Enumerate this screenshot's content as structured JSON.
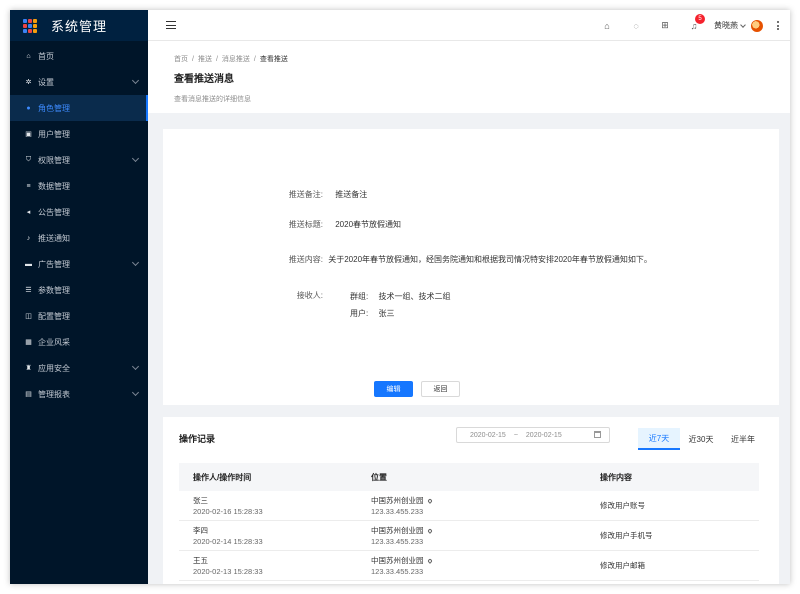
{
  "sidebar": {
    "title": "系统管理",
    "items": [
      {
        "label": "首页",
        "icon": "home-icon",
        "glyph": "⌂",
        "expand": false
      },
      {
        "label": "设置",
        "icon": "gear-icon",
        "glyph": "✲",
        "expand": true
      },
      {
        "label": "角色管理",
        "icon": "role-icon",
        "glyph": "●",
        "expand": false,
        "active": true
      },
      {
        "label": "用户管理",
        "icon": "user-icon",
        "glyph": "▣",
        "expand": false
      },
      {
        "label": "权限管理",
        "icon": "shield-icon",
        "glyph": "⛉",
        "expand": true
      },
      {
        "label": "数据管理",
        "icon": "data-icon",
        "glyph": "≡",
        "expand": false
      },
      {
        "label": "公告管理",
        "icon": "megaphone-icon",
        "glyph": "◂",
        "expand": false
      },
      {
        "label": "推送通知",
        "icon": "bell-icon",
        "glyph": "♪",
        "expand": false
      },
      {
        "label": "广告管理",
        "icon": "ad-icon",
        "glyph": "▬",
        "expand": true
      },
      {
        "label": "参数管理",
        "icon": "params-icon",
        "glyph": "☰",
        "expand": false
      },
      {
        "label": "配置管理",
        "icon": "config-icon",
        "glyph": "◫",
        "expand": false
      },
      {
        "label": "企业风采",
        "icon": "grid-icon",
        "glyph": "▦",
        "expand": false
      },
      {
        "label": "应用安全",
        "icon": "lock-icon",
        "glyph": "♜",
        "expand": true
      },
      {
        "label": "管理报表",
        "icon": "report-icon",
        "glyph": "▤",
        "expand": true
      }
    ]
  },
  "topbar": {
    "notification_count": "5",
    "username": "黄晓燕"
  },
  "header": {
    "breadcrumb": [
      "首页",
      "推送",
      "消息推送",
      "查看推送"
    ],
    "title": "查看推送消息",
    "description": "查看消息推送的详细信息"
  },
  "detail": {
    "remark_label": "推送备注:",
    "remark_value": "推送备注",
    "title_label": "推送标题:",
    "title_value": "2020春节放假通知",
    "content_label": "推送内容:",
    "content_value": "关于2020年春节放假通知，经国务院通知和根据我司情况特安排2020年春节放假通知如下。",
    "receiver_label": "接收人:",
    "group_label": "群组:",
    "group_value": "技术一组、技术二组",
    "user_label": "用户:",
    "user_value": "张三",
    "edit_button": "编辑",
    "back_button": "返回"
  },
  "records": {
    "title": "操作记录",
    "date_start": "2020-02-15",
    "date_sep": "~",
    "date_end": "2020-02-15",
    "tabs": [
      "近7天",
      "近30天",
      "近半年"
    ],
    "active_tab": 0,
    "columns": [
      "操作人/操作时间",
      "位置",
      "操作内容"
    ],
    "rows": [
      {
        "name": "张三",
        "time": "2020-02-16 15:28:33",
        "place": "中国苏州创业园",
        "ip": "123.33.455.233",
        "action": "修改用户账号"
      },
      {
        "name": "李四",
        "time": "2020-02-14 15:28:33",
        "place": "中国苏州创业园",
        "ip": "123.33.455.233",
        "action": "修改用户手机号"
      },
      {
        "name": "王五",
        "time": "2020-02-13 15:28:33",
        "place": "中国苏州创业园",
        "ip": "123.33.455.233",
        "action": "修改用户邮箱"
      }
    ]
  },
  "colors": {
    "sidebar_bg": "#001529",
    "accent": "#1677ff",
    "badge": "#f5222d"
  }
}
